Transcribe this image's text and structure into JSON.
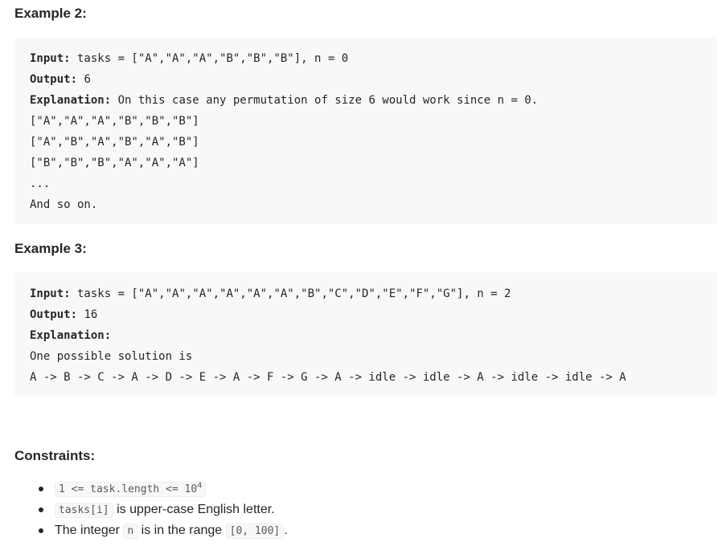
{
  "example2": {
    "heading": "Example 2:",
    "input_label": "Input:",
    "input_value": " tasks = [\"A\",\"A\",\"A\",\"B\",\"B\",\"B\"], n = 0",
    "output_label": "Output:",
    "output_value": " 6",
    "explanation_label": "Explanation:",
    "explanation_value": " On this case any permutation of size 6 would work since n = 0.",
    "lines": [
      "[\"A\",\"A\",\"A\",\"B\",\"B\",\"B\"]",
      "[\"A\",\"B\",\"A\",\"B\",\"A\",\"B\"]",
      "[\"B\",\"B\",\"B\",\"A\",\"A\",\"A\"]",
      "...",
      "And so on."
    ]
  },
  "example3": {
    "heading": "Example 3:",
    "input_label": "Input:",
    "input_value": " tasks = [\"A\",\"A\",\"A\",\"A\",\"A\",\"A\",\"B\",\"C\",\"D\",\"E\",\"F\",\"G\"], n = 2",
    "output_label": "Output:",
    "output_value": " 16",
    "explanation_label": "Explanation:",
    "lines": [
      "One possible solution is",
      "A -> B -> C -> A -> D -> E -> A -> F -> G -> A -> idle -> idle -> A -> idle -> idle -> A"
    ]
  },
  "constraints": {
    "heading": "Constraints:",
    "items": [
      {
        "code_base": "1 <= task.length <= 10",
        "code_sup": "4"
      },
      {
        "code": "tasks[i]",
        "text_after": " is upper-case English letter."
      },
      {
        "text_before": "The integer ",
        "code_n": "n",
        "text_mid": " is in the range ",
        "code_range": "[0, 100]",
        "text_after": "."
      }
    ]
  }
}
